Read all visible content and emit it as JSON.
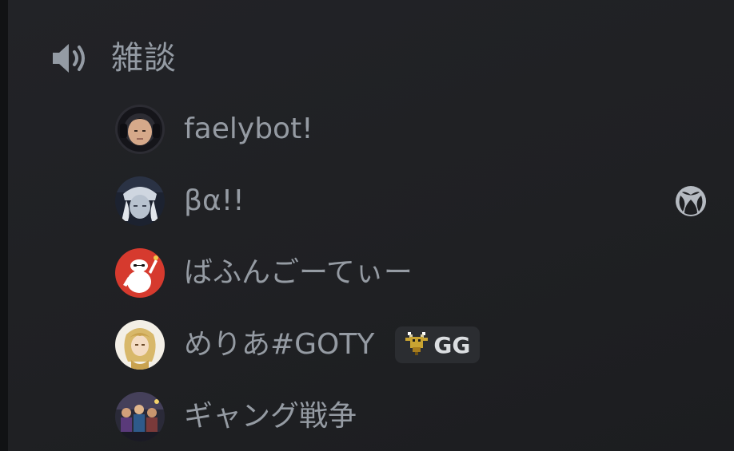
{
  "channel": {
    "icon": "speaker-icon",
    "name": "雑談"
  },
  "members": [
    {
      "name": "faelybot!",
      "avatar": "person-headphones-avatar"
    },
    {
      "name": "βα!!",
      "avatar": "anime-character-avatar",
      "activity_icon": "xbox-icon"
    },
    {
      "name": "ばふんごーてぃー",
      "avatar": "white-robot-avatar"
    },
    {
      "name": "めりあ#GOTY",
      "avatar": "blonde-character-avatar",
      "badge": {
        "icon": "goat-icon",
        "label": "GG"
      }
    },
    {
      "name": "ギャング戦争",
      "avatar": "group-photo-avatar"
    }
  ],
  "colors": {
    "background": "#1e1f22",
    "text_muted": "#949ba4",
    "badge_bg": "#2b2d31",
    "badge_text": "#dbdee1"
  }
}
